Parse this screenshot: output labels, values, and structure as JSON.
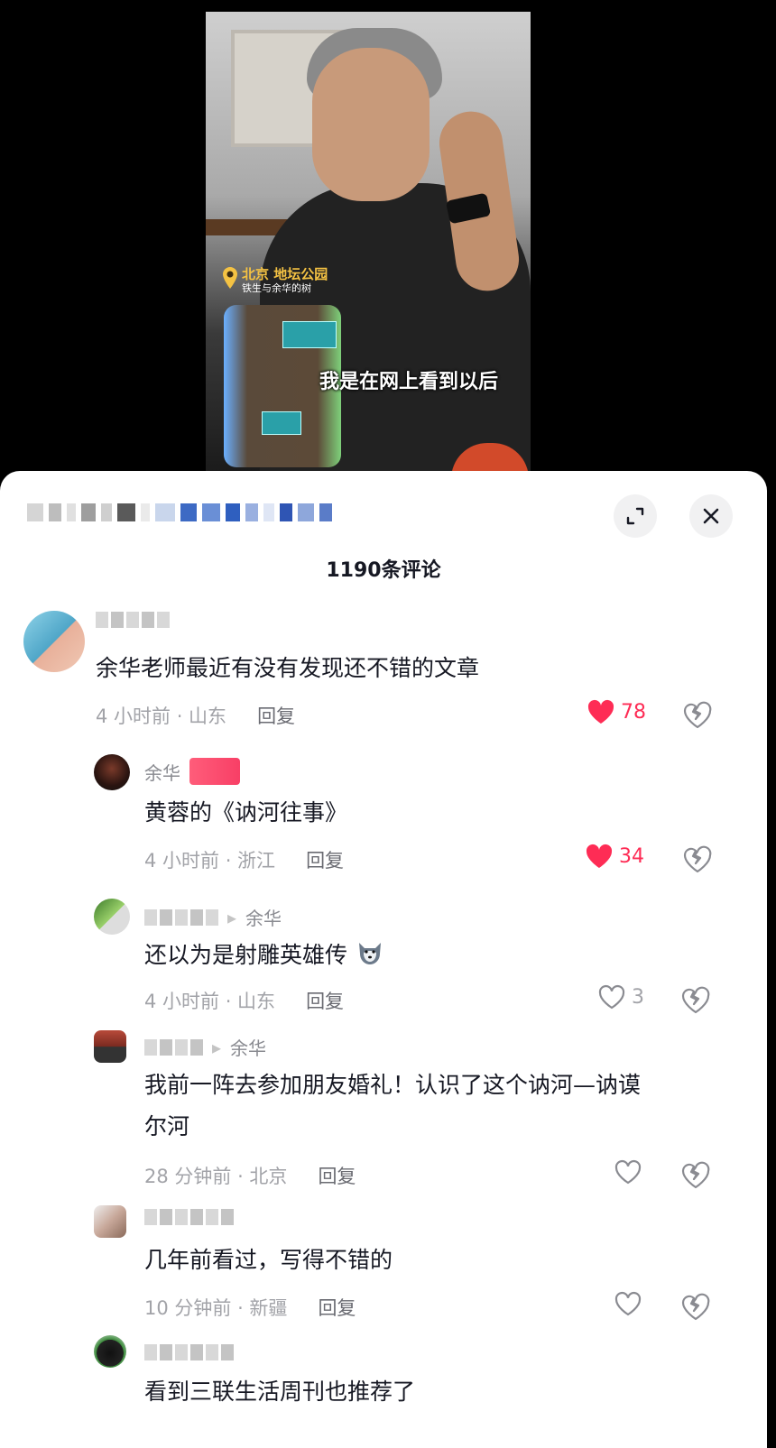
{
  "video": {
    "location_title": "北京 地坛公园",
    "location_subtitle": "铁生与余华的树",
    "subtitle": "我是在网上看到以后"
  },
  "sheet": {
    "comment_count_label": "1190条评论",
    "expand_icon": "expand-icon",
    "close_icon": "close-icon"
  },
  "comments": [
    {
      "text": "余华老师最近有没有发现还不错的文章",
      "time": "4 小时前 · 山东",
      "reply_label": "回复",
      "likes": "78",
      "liked": true
    },
    {
      "author": "余华",
      "text": "黄蓉的《讷河往事》",
      "time": "4 小时前 · 浙江",
      "reply_label": "回复",
      "likes": "34",
      "liked": true
    },
    {
      "reply_to": "余华",
      "text": "还以为是射雕英雄传",
      "time": "4 小时前 · 山东",
      "reply_label": "回复",
      "likes": "3",
      "liked": false
    },
    {
      "reply_to": "余华",
      "text_line1": "我前一阵去参加朋友婚礼！认识了这个讷河—讷谟",
      "text_line2": "尔河",
      "time": "28 分钟前 · 北京",
      "reply_label": "回复",
      "likes": "",
      "liked": false
    },
    {
      "text": "几年前看过，写得不错的",
      "time": "10 分钟前 · 新疆",
      "reply_label": "回复",
      "likes": "",
      "liked": false
    },
    {
      "text": "看到三联生活周刊也推荐了"
    }
  ],
  "colors": {
    "like_red": "#fe2c55",
    "text_primary": "#161823",
    "text_secondary": "#a2a3a8"
  }
}
